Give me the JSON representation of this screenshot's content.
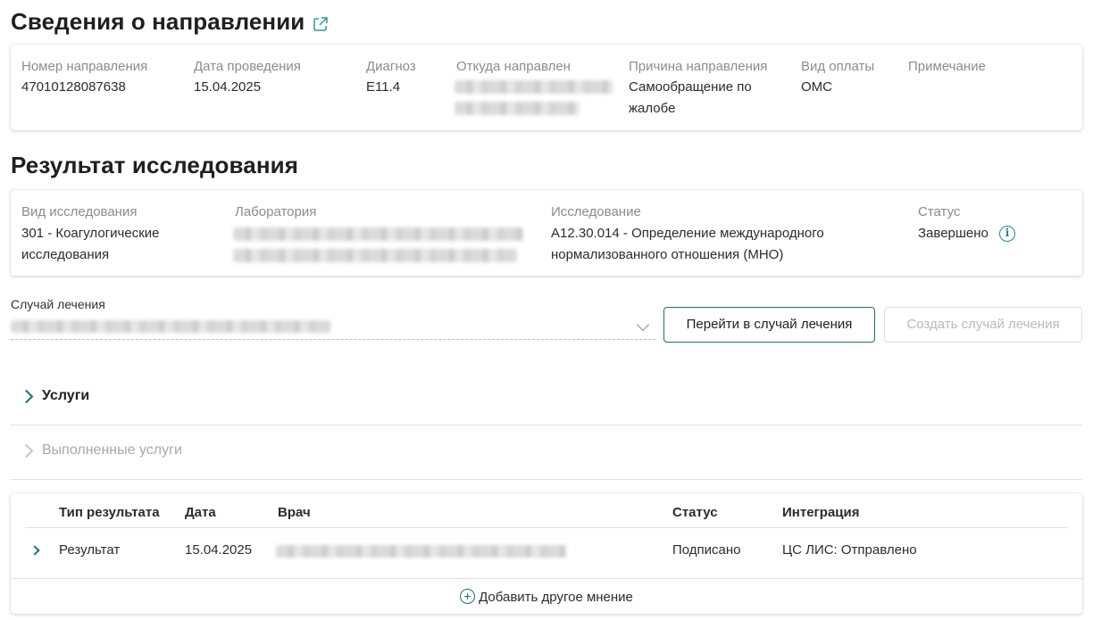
{
  "referral": {
    "title": "Сведения о направлении",
    "fields": [
      {
        "label": "Номер направления",
        "value": "47010128087638"
      },
      {
        "label": "Дата проведения",
        "value": "15.04.2025"
      },
      {
        "label": "Диагноз",
        "value": "E11.4"
      },
      {
        "label": "Откуда направлен",
        "value": ""
      },
      {
        "label": "Причина направления",
        "value": "Самообращение по жалобе"
      },
      {
        "label": "Вид оплаты",
        "value": "ОМС"
      },
      {
        "label": "Примечание",
        "value": ""
      }
    ]
  },
  "result": {
    "title": "Результат исследования",
    "fields": [
      {
        "label": "Вид исследования",
        "value": "301 - Коагулогические исследования"
      },
      {
        "label": "Лаборатория",
        "value": ""
      },
      {
        "label": "Исследование",
        "value": "A12.30.014 - Определение международного нормализованного отношения (МНО)"
      },
      {
        "label": "Статус",
        "value": "Завершено"
      }
    ]
  },
  "case": {
    "label": "Случай лечения",
    "goto_button": "Перейти в случай лечения",
    "create_button": "Создать случай лечения"
  },
  "sections": {
    "services": "Услуги",
    "performed_services": "Выполненные услуги"
  },
  "table": {
    "headers": [
      "Тип результата",
      "Дата",
      "Врач",
      "Статус",
      "Интеграция"
    ],
    "rows": [
      {
        "type": "Результат",
        "date": "15.04.2025",
        "doctor": "",
        "status": "Подписано",
        "integration": "ЦС ЛИС: Отправлено"
      }
    ],
    "add_label": "Добавить другое мнение"
  },
  "colors": {
    "accent": "#1e6f73",
    "muted": "#8c8c8c"
  }
}
